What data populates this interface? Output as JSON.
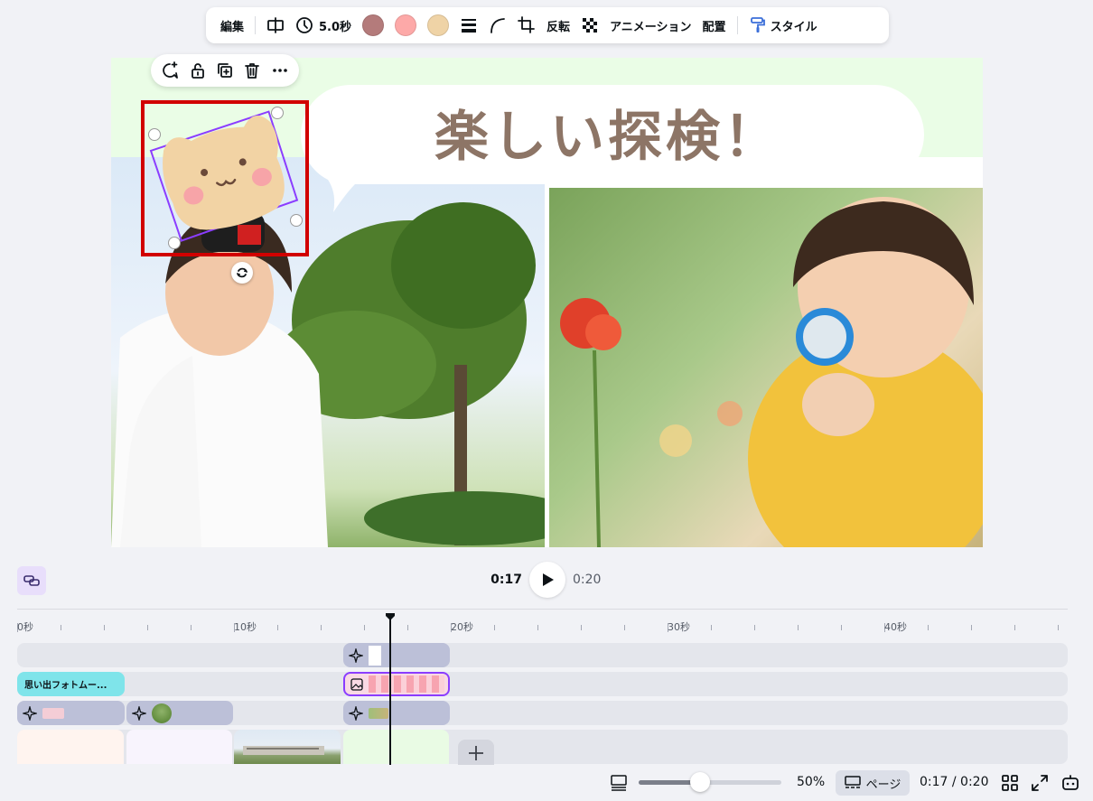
{
  "toolbar": {
    "edit": "編集",
    "duration": "5.0秒",
    "colors": [
      "#b47b7b",
      "#fda9a8",
      "#efd3a6"
    ],
    "flip": "反転",
    "animation": "アニメーション",
    "arrange": "配置",
    "style": "スタイル"
  },
  "canvas": {
    "title": "楽しい探検！",
    "bg_top": "#eafde6",
    "accent": "#8b3dff",
    "selection_frame": "#d10000"
  },
  "playback": {
    "current": "0:17",
    "total": "0:20"
  },
  "timeline": {
    "ruler": [
      "0秒",
      "10秒",
      "20秒",
      "30秒",
      "40秒"
    ],
    "text_clip_label": "思い出フォトムー...",
    "pages_bg": [
      "#fff4ef",
      "#f8f4fd",
      "",
      "#e9fbe4"
    ]
  },
  "bottom": {
    "zoom": "50%",
    "pages_label": "ページ",
    "time": "0:17 / 0:20"
  }
}
